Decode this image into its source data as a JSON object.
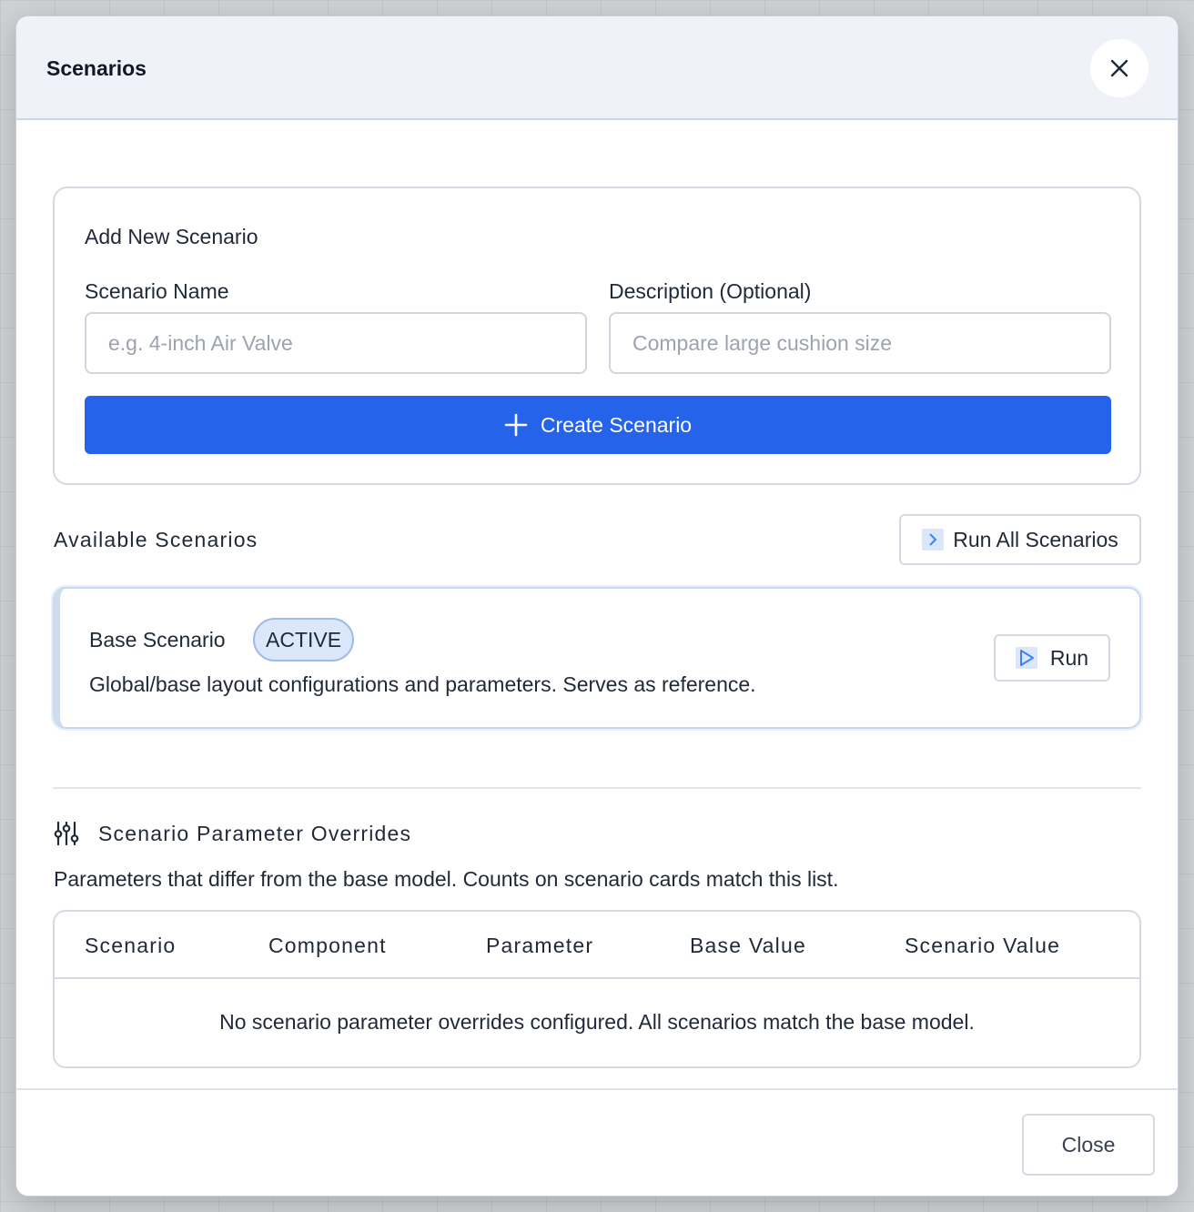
{
  "modal": {
    "title": "Scenarios",
    "close_icon": "close-icon"
  },
  "new_scenario": {
    "title": "Add New Scenario",
    "name_label": "Scenario Name",
    "name_placeholder": "e.g. 4-inch Air Valve",
    "name_value": "",
    "description_label": "Description (Optional)",
    "description_placeholder": "Compare large cushion size",
    "description_value": "",
    "create_label": "Create Scenario",
    "create_icon": "plus-icon",
    "create_color": "#2563eb"
  },
  "available": {
    "title": "Available Scenarios",
    "run_all_label": "Run All Scenarios",
    "run_all_icon": "chevron-right-icon",
    "scenarios": [
      {
        "name": "Base Scenario",
        "badge": "ACTIVE",
        "description": "Global/base layout configurations and parameters. Serves as reference.",
        "run_label": "Run",
        "run_icon": "play-icon"
      }
    ]
  },
  "overrides": {
    "icon": "sliders-icon",
    "title": "Scenario Parameter Overrides",
    "description": "Parameters that differ from the base model. Counts on scenario cards match this list.",
    "columns": [
      "Scenario",
      "Component",
      "Parameter",
      "Base Value",
      "Scenario Value"
    ],
    "empty_message": "No scenario parameter overrides configured. All scenarios match the base model."
  },
  "footer": {
    "close_label": "Close"
  },
  "colors": {
    "accent": "#2563eb",
    "header_bg": "#eff3f9",
    "badge_bg": "#dbe8fb",
    "badge_border": "#9dbcea"
  }
}
